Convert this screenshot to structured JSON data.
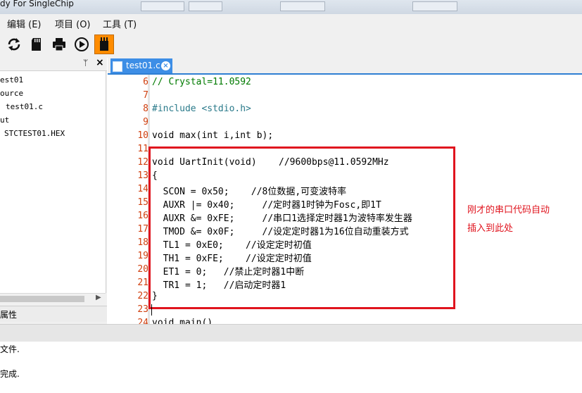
{
  "window": {
    "title": "dy For SingleChip"
  },
  "menu": [
    {
      "label": "编辑 (E)"
    },
    {
      "label": "项目 (O)"
    },
    {
      "label": "工具 (T)"
    }
  ],
  "toolbar": [
    {
      "icon": "refresh-icon"
    },
    {
      "icon": "sd-card-icon"
    },
    {
      "icon": "printer-icon"
    },
    {
      "icon": "play-icon"
    },
    {
      "icon": "chip-icon",
      "active": true
    }
  ],
  "left_panel": {
    "pin_glyph": "ᛘ",
    "close_glyph": "×",
    "tree": [
      "est01",
      "ource",
      "test01.c",
      "ut",
      "STCTEST01.HEX"
    ],
    "properties_label": "属性"
  },
  "tab": {
    "label": "test01.c",
    "close": "×"
  },
  "editor": {
    "line_numbers": [
      "6",
      "7",
      "8",
      "9",
      "10",
      "11",
      "12",
      "13",
      "14",
      "15",
      "16",
      "17",
      "18",
      "19",
      "20",
      "21",
      "22",
      "23",
      "24"
    ],
    "lines": [
      "// Crystal=11.0592",
      "",
      "#include <stdio.h>",
      "",
      "void max(int i,int b);",
      "",
      "void UartInit(void)    //9600bps@11.0592MHz",
      "{",
      "  SCON = 0x50;    //8位数据,可变波特率",
      "  AUXR |= 0x40;     //定时器1时钟为Fosc,即1T",
      "  AUXR &= 0xFE;     //串口1选择定时器1为波特率发生器",
      "  TMOD &= 0x0F;     //设定定时器1为16位自动重装方式",
      "  TL1 = 0xE0;    //设定定时初值",
      "  TH1 = 0xFE;    //设定定时初值",
      "  ET1 = 0;   //禁止定时器1中断",
      "  TR1 = 1;   //启动定时器1",
      "}",
      "",
      "void main()"
    ]
  },
  "annotation": [
    "刚才的串口代码自动",
    "插入到此处"
  ],
  "output": [
    "文件.",
    "完成."
  ],
  "colors": {
    "accent": "#3d8ee6",
    "annotation": "#e0141e",
    "active_tool": "#ff8c00"
  }
}
